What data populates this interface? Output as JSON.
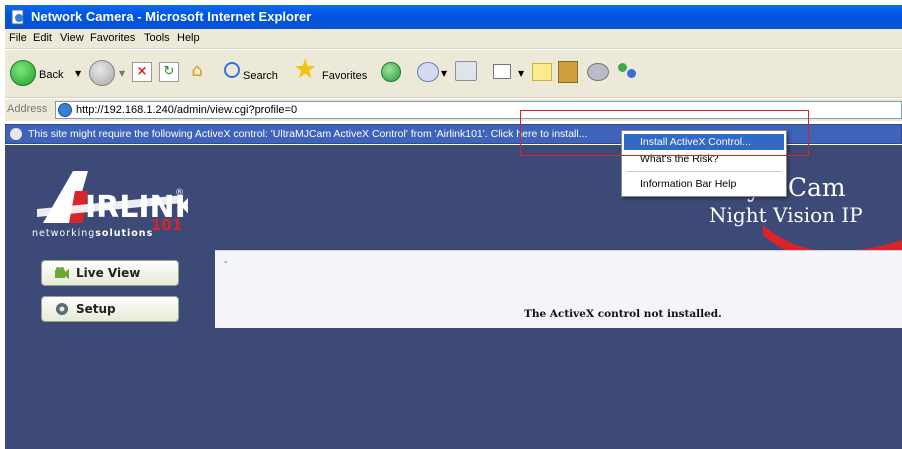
{
  "window": {
    "title": "Network Camera - Microsoft Internet Explorer"
  },
  "menubar": {
    "items": [
      "File",
      "Edit",
      "View",
      "Favorites",
      "Tools",
      "Help"
    ]
  },
  "toolbar": {
    "back_label": "Back",
    "search_label": "Search",
    "favorites_label": "Favorites"
  },
  "address": {
    "label": "Address",
    "url": "http://192.168.1.240/admin/view.cgi?profile=0"
  },
  "infobar": {
    "message": "This site might require the following ActiveX control: 'UltraMJCam ActiveX Control' from 'Airlink101'. Click here to install..."
  },
  "context_menu": {
    "items": [
      "Install ActiveX Control...",
      "What's the Risk?",
      "Information Bar Help"
    ]
  },
  "page": {
    "logo_tagline_prefix": "networking",
    "logo_tagline_suffix": "solutions",
    "header_line1": "yIPCam",
    "header_line2": "Night Vision IP",
    "live_view_label": "Live View",
    "setup_label": "Setup",
    "content_dash": "-",
    "content_message": "The ActiveX control not installed."
  },
  "colors": {
    "titlebar": "#0053e0",
    "page_bg": "#3d4a78",
    "infobar": "#3f63b8",
    "highlight": "#316ac5",
    "red_outline": "#d22222"
  }
}
